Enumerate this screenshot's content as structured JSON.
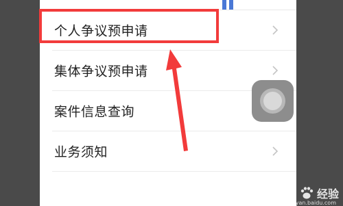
{
  "menu": {
    "items": [
      {
        "label": "个人争议预申请"
      },
      {
        "label": "集体争议预申请"
      },
      {
        "label": "案件信息查询"
      },
      {
        "label": "业务须知"
      }
    ]
  },
  "annotation": {
    "highlight_color": "#f23b3b",
    "arrow_color": "#f23b3b"
  },
  "watermark": {
    "brand": "Bai",
    "brand_cn": "经验",
    "subtext": "jingyan.baidu.com"
  },
  "colors": {
    "background": "#4a4a4a",
    "panel": "#ffffff",
    "text": "#222222",
    "chevron": "#c4c4c4",
    "tab_accent": "#4a78d6"
  }
}
